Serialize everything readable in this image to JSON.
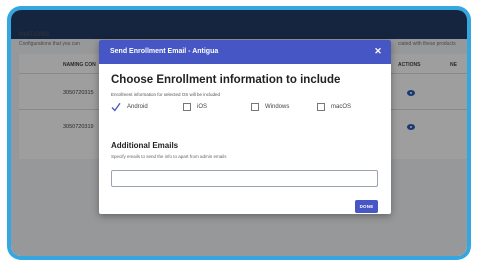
{
  "background": {
    "section_title": "INATIONS",
    "section_desc": "Configurations that you can",
    "right_desc": "ciated with these products",
    "columns": [
      "NAMING CON",
      "ACTIONS",
      "NE"
    ],
    "rows": [
      {
        "name": "3050720315"
      },
      {
        "name": "3050720319"
      }
    ]
  },
  "modal": {
    "title": "Send Enrollment Email - Antigua",
    "close_icon": "close-icon",
    "heading": "Choose Enrollment information to include",
    "hint": "Enrollment information for selected OS will be included",
    "os_options": [
      {
        "label": "Android",
        "checked": true
      },
      {
        "label": "iOS",
        "checked": false
      },
      {
        "label": "Windows",
        "checked": false
      },
      {
        "label": "macOS",
        "checked": false
      }
    ],
    "emails_heading": "Additional Emails",
    "emails_desc": "Specify emails to send the info to apart from admin emails",
    "email_value": "",
    "done_label": "DONE"
  },
  "colors": {
    "frame": "#34a7e0",
    "topbar": "#243c66",
    "accent": "#4656c4"
  }
}
